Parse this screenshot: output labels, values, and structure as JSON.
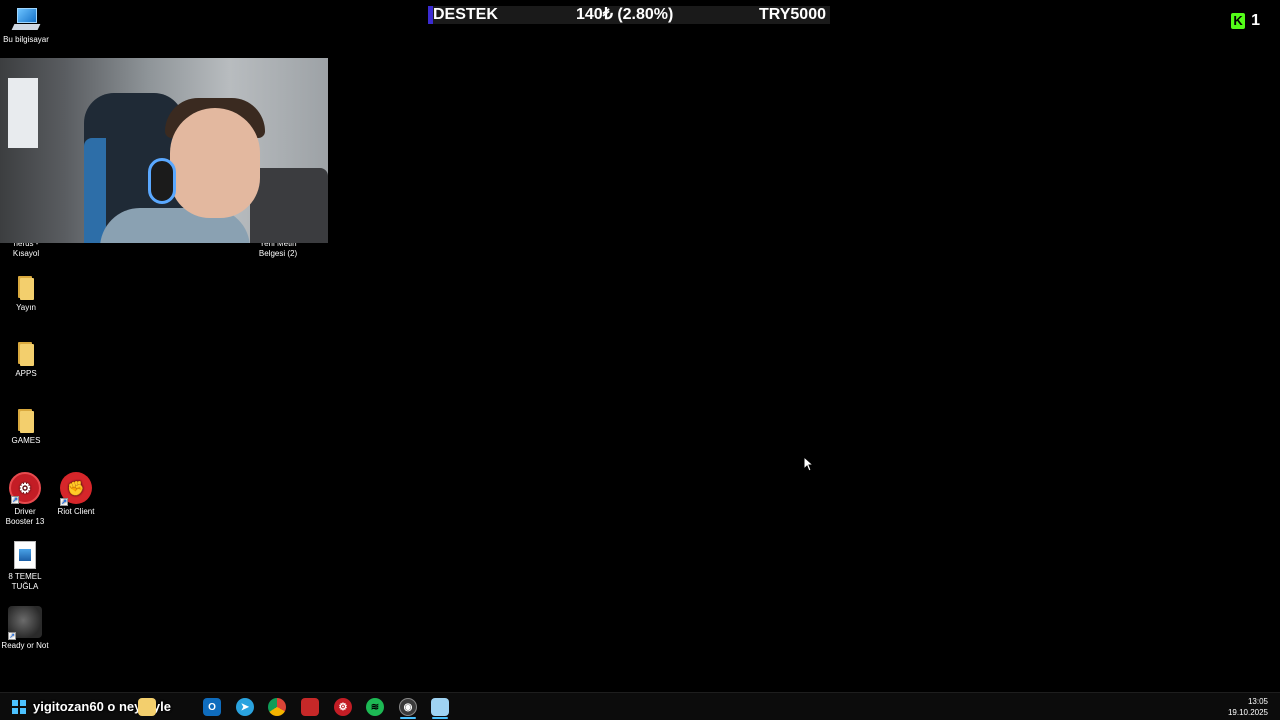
{
  "desktop": {
    "icons": [
      {
        "label": "Bu bilgisayar",
        "icon": "computer-icon"
      },
      {
        "label": "Kısayol",
        "label_top": "nerus -",
        "icon": "shortcut-icon"
      },
      {
        "label": "Belgesi (2)",
        "label_top": "Yeni Metin",
        "icon": "text-document-icon"
      },
      {
        "label": "Yayın",
        "icon": "folder-icon"
      },
      {
        "label": "APPS",
        "icon": "folder-icon"
      },
      {
        "label": "GAMES",
        "icon": "folder-icon"
      },
      {
        "label": "Driver Booster 13",
        "icon": "driver-booster-icon"
      },
      {
        "label": "Riot Client",
        "icon": "riot-client-icon"
      },
      {
        "label": "8 TEMEL TUĞLA",
        "icon": "image-file-icon"
      },
      {
        "label": "Ready or Not",
        "icon": "ready-or-not-icon"
      }
    ]
  },
  "banner": {
    "left": "DESTEK",
    "middle": "140₺ (2.80%)",
    "right": "TRY5000",
    "accent_color": "#3b2bd1"
  },
  "kick": {
    "count": "1",
    "brand_color": "#53fc18",
    "letter": "K"
  },
  "taskbar": {
    "chat_text": "yigitozan60 o ney öyle",
    "apps": [
      {
        "name": "file-explorer-icon",
        "color": "#f3cf6d"
      },
      {
        "name": "outlook-icon",
        "color": "#0f6cbd"
      },
      {
        "name": "telegram-icon",
        "color": "#2aa3df"
      },
      {
        "name": "chrome-icon",
        "color": "#db4437"
      },
      {
        "name": "stream-app-icon",
        "color": "#c62828"
      },
      {
        "name": "driver-booster-icon",
        "color": "#c31d25"
      },
      {
        "name": "spotify-icon",
        "color": "#1db954"
      },
      {
        "name": "obs-icon",
        "color": "#3b3b3b"
      },
      {
        "name": "notepad-icon",
        "color": "#9fd3f2"
      }
    ],
    "clock_time": "13:05",
    "clock_date": "19.10.2025"
  }
}
